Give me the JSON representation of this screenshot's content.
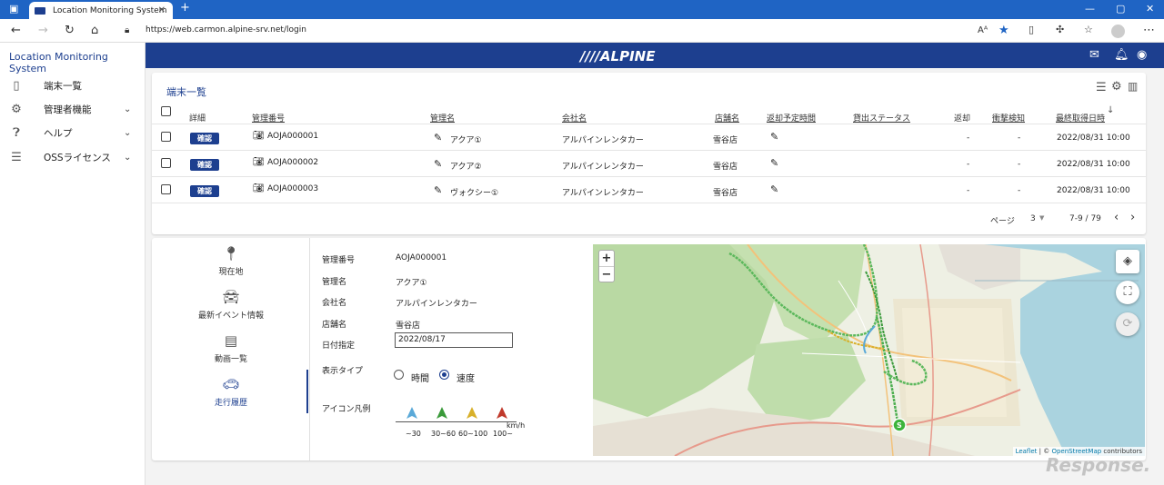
{
  "browser": {
    "tab_title": "Location Monitoring System",
    "url": "https://web.carmon.alpine-srv.net/login"
  },
  "sidebar": {
    "title": "Location Monitoring System",
    "items": [
      {
        "label": "端末一覧",
        "icon": "phone-icon"
      },
      {
        "label": "管理者機能",
        "icon": "gear-icon"
      },
      {
        "label": "ヘルプ",
        "icon": "help-icon"
      },
      {
        "label": "OSSライセンス",
        "icon": "list-icon"
      }
    ]
  },
  "header": {
    "logo": "////ALPINE",
    "colors": {
      "brand": "#1d3f8f"
    }
  },
  "list": {
    "title": "端末一覧",
    "columns": [
      "詳細",
      "管理番号",
      "管理名",
      "会社名",
      "店舗名",
      "返却予定時間",
      "貸出ステータス",
      "返却",
      "衝撃検知",
      "最終取得日時"
    ],
    "rows": [
      {
        "detail": "確認",
        "id": "AOJA000001",
        "name": "アクア①",
        "company": "アルパインレンタカー",
        "store": "雪谷店",
        "return": "-",
        "impact": "-",
        "last": "2022/08/31 10:00"
      },
      {
        "detail": "確認",
        "id": "AOJA000002",
        "name": "アクア②",
        "company": "アルパインレンタカー",
        "store": "雪谷店",
        "return": "-",
        "impact": "-",
        "last": "2022/08/31 10:00"
      },
      {
        "detail": "確認",
        "id": "AOJA000003",
        "name": "ヴォクシー①",
        "company": "アルパインレンタカー",
        "store": "雪谷店",
        "return": "-",
        "impact": "-",
        "last": "2022/08/31 10:00"
      }
    ],
    "pager": {
      "label": "ページ",
      "page": "3",
      "range": "7-9 / 79"
    }
  },
  "detail": {
    "nav": [
      {
        "label": "現在地",
        "icon": "location-pin-icon"
      },
      {
        "label": "最新イベント情報",
        "icon": "car-event-icon"
      },
      {
        "label": "動画一覧",
        "icon": "video-list-icon"
      },
      {
        "label": "走行履歴",
        "icon": "car-icon"
      }
    ],
    "fields": {
      "id_label": "管理番号",
      "id_value": "AOJA000001",
      "name_label": "管理名",
      "name_value": "アクア①",
      "company_label": "会社名",
      "company_value": "アルパインレンタカー",
      "store_label": "店舗名",
      "store_value": "雪谷店",
      "date_label": "日付指定",
      "date_value": "2022/08/17",
      "type_label": "表示タイプ",
      "type_time": "時間",
      "type_speed": "速度",
      "legend_label": "アイコン凡例"
    },
    "legend": [
      {
        "label": "~30",
        "color": "#5aa9d8"
      },
      {
        "label": "30~60",
        "color": "#3a9a3a"
      },
      {
        "label": "60~100",
        "color": "#d8b02a"
      },
      {
        "label": "100~",
        "color": "#c0392b"
      }
    ],
    "legend_unit": "km/h",
    "map": {
      "zoom_in": "+",
      "zoom_out": "−",
      "start_marker": "S",
      "attribution_leaflet": "Leaflet",
      "attribution_sep": " | © ",
      "attribution_osm": "OpenStreetMap",
      "attribution_tail": " contributors"
    }
  },
  "watermark": "Response."
}
